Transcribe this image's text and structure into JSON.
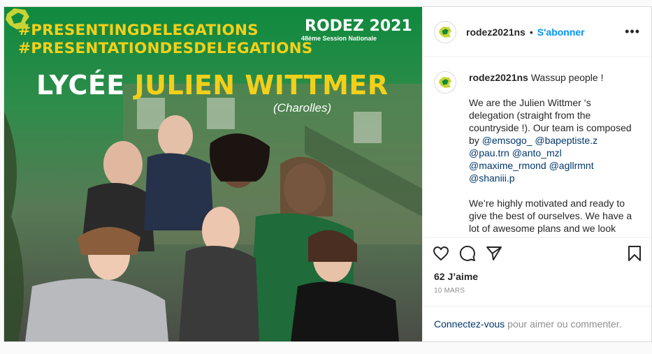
{
  "photo": {
    "hashtag_1": "#PRESENTINGDELEGATIONS",
    "hashtag_2": "#PRESENTATIONDESDELEGATIONS",
    "event_title": "RODEZ 2021",
    "event_subtitle": "48ème Session Nationale",
    "school_prefix": "LYCÉE",
    "school_name": "JULIEN WITTMER",
    "city": "(Charolles)"
  },
  "header": {
    "username": "rodez2021ns",
    "separator": "•",
    "follow_label": "S'abonner",
    "more_label": "•••"
  },
  "caption": {
    "username": "rodez2021ns",
    "greeting": "Wassup people !",
    "para2_intro": "We are the Julien Wittmer ‘s delegation (straight from the countryside !). Our team is composed by",
    "mentions": [
      "@emsogo_",
      "@bapeptiste.z",
      "@pau.trn",
      "@anto_mzl",
      "@maxime_rmond",
      "@agllrmnt",
      "@shaniii.p"
    ],
    "para3": "We’re highly motivated and ready to give the best of ourselves. We have a lot of awesome plans and we look forward to presenting them to you."
  },
  "stats": {
    "likes": "62 J’aime",
    "date": "10 MARS"
  },
  "footer": {
    "login_link": "Connectez-vous",
    "login_rest": "pour aimer ou commenter."
  },
  "colors": {
    "brand_green": "#0f8a3e",
    "tag_yellow": "#f2d01a",
    "link_blue": "#0095f6"
  }
}
